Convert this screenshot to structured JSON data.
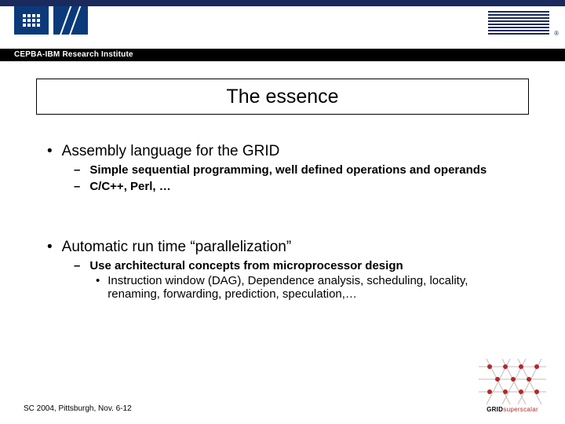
{
  "header": {
    "institute_label": "CEPBA-IBM Research Institute",
    "ibm_reg": "®"
  },
  "title": "The essence",
  "bullets": {
    "0": {
      "text": "Assembly language for the GRID",
      "subs": {
        "0": "Simple sequential programming, well defined operations and operands",
        "1": "C/C++, Perl, …"
      }
    },
    "1": {
      "text": "Automatic run time “parallelization”",
      "subs": {
        "0": "Use architectural concepts from microprocessor design",
        "subsubs": {
          "0": "Instruction window (DAG), Dependence analysis, scheduling, locality, renaming, forwarding, prediction, speculation,…"
        }
      }
    }
  },
  "footer": "SC 2004, Pittsburgh, Nov. 6-12",
  "grid_logo": {
    "label_bold": "GRID",
    "label_rest": "superscalar"
  }
}
